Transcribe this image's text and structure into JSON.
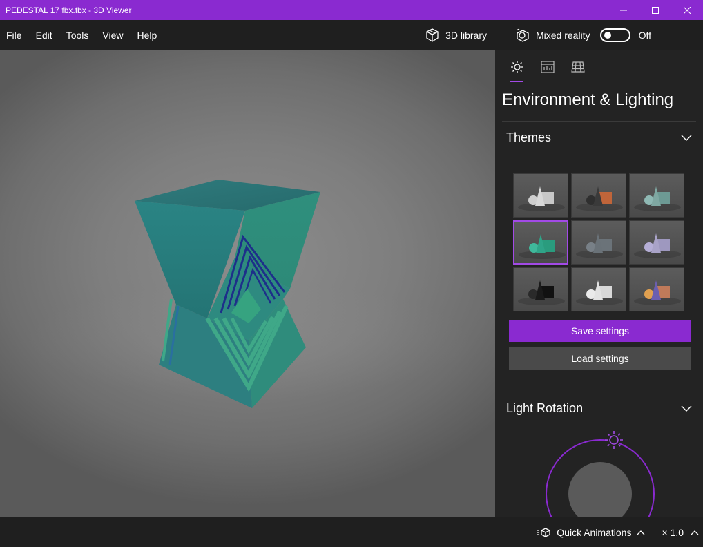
{
  "window": {
    "title": "PEDESTAL 17 fbx.fbx - 3D Viewer",
    "accent_color": "#8a2ad0"
  },
  "menu": {
    "items": [
      "File",
      "Edit",
      "Tools",
      "View",
      "Help"
    ],
    "library_label": "3D library",
    "mixed_reality_label": "Mixed reality",
    "mixed_reality_state": "Off"
  },
  "panel": {
    "tabs": [
      "sun-icon",
      "stats-icon",
      "grid-icon"
    ],
    "title": "Environment & Lighting",
    "themes_label": "Themes",
    "themes": [
      {
        "name": "light-gray-theme",
        "colors": [
          "#d8d8d8",
          "#cfcfcf",
          "#c8c8c8"
        ]
      },
      {
        "name": "dark-orange-theme",
        "colors": [
          "#3a3a3a",
          "#2f2f2f",
          "#c0653a"
        ]
      },
      {
        "name": "teal-gray-theme",
        "colors": [
          "#7fa8a2",
          "#8fb9b4",
          "#6d9a94"
        ]
      },
      {
        "name": "teal-theme",
        "colors": [
          "#2fa488",
          "#3fb89b",
          "#2a9c7e"
        ]
      },
      {
        "name": "slate-theme",
        "colors": [
          "#6a7278",
          "#788087",
          "#6b7379"
        ]
      },
      {
        "name": "lavender-theme",
        "colors": [
          "#a9a3c8",
          "#b5aed6",
          "#9e98bf"
        ]
      },
      {
        "name": "black-theme",
        "colors": [
          "#1a1a1a",
          "#2a2a2a",
          "#111111"
        ]
      },
      {
        "name": "white-theme",
        "colors": [
          "#e2e2e2",
          "#eaeaea",
          "#d8d8d8"
        ]
      },
      {
        "name": "sunset-theme",
        "colors": [
          "#6b5fb0",
          "#e0a050",
          "#c07a5a"
        ]
      }
    ],
    "selected_theme_index": 3,
    "save_label": "Save settings",
    "load_label": "Load settings",
    "light_rotation_label": "Light Rotation"
  },
  "status": {
    "quick_animations_label": "Quick Animations",
    "speed_label": "× 1.0"
  }
}
